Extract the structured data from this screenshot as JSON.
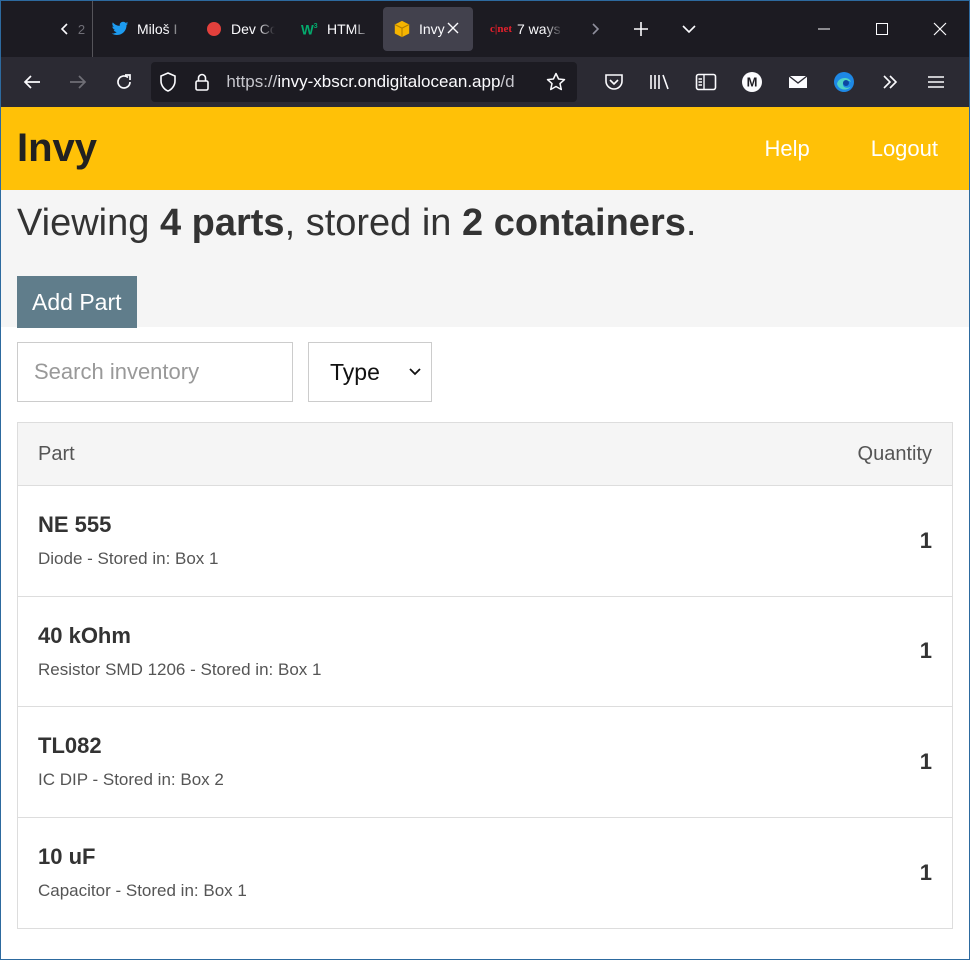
{
  "browser": {
    "tabs": [
      {
        "label": "2",
        "icon": "partial-tab"
      },
      {
        "label": "Miloš I",
        "icon": "twitter-icon"
      },
      {
        "label": "Dev Co",
        "icon": "red-dot-icon"
      },
      {
        "label": "HTML",
        "icon": "w3schools-icon"
      },
      {
        "label": "Invy",
        "icon": "box-icon",
        "active": true
      },
      {
        "label": "7 ways",
        "icon": "cnet-icon"
      }
    ],
    "url_prefix": "https://",
    "url_host": "invy-xbscr.ondigitalocean.app",
    "url_path": "/d",
    "cnet_logo": "c|net"
  },
  "header": {
    "brand": "Invy",
    "help": "Help",
    "logout": "Logout"
  },
  "summary": {
    "prefix": "Viewing ",
    "parts": "4 parts",
    "middle": ", stored in ",
    "containers": "2 containers",
    "suffix": ".",
    "add_button": "Add Part"
  },
  "filters": {
    "search_placeholder": "Search inventory",
    "type_selected": "Type"
  },
  "table": {
    "col_part": "Part",
    "col_quantity": "Quantity",
    "rows": [
      {
        "name": "NE 555",
        "meta": "Diode - Stored in: Box 1",
        "qty": "1"
      },
      {
        "name": "40 kOhm",
        "meta": "Resistor SMD 1206 - Stored in: Box 1",
        "qty": "1"
      },
      {
        "name": "TL082",
        "meta": "IC DIP - Stored in: Box 2",
        "qty": "1"
      },
      {
        "name": "10 uF",
        "meta": "Capacitor - Stored in: Box 1",
        "qty": "1"
      }
    ]
  },
  "colors": {
    "header_bg": "#ffc107",
    "button_bg": "#607d8b",
    "tabbar_bg": "#1c1b22",
    "navbar_bg": "#2b2a33"
  }
}
